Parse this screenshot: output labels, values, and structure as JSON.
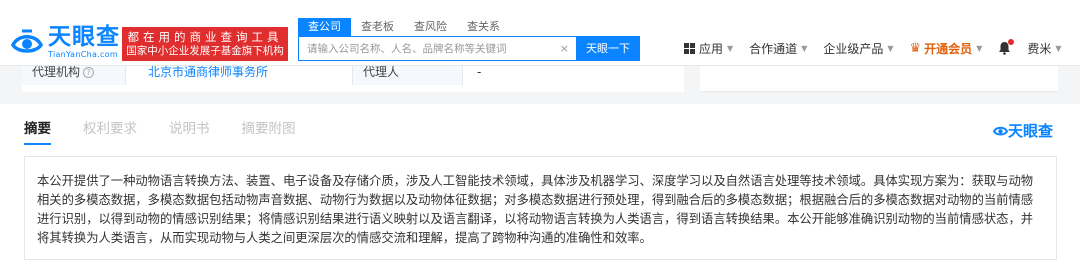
{
  "header": {
    "logo": {
      "name": "天眼查",
      "url": "TianYanCha.com"
    },
    "slogan": {
      "line1": "都在用的商业查询工具",
      "line2": "国家中小企业发展子基金旗下机构"
    },
    "search_tabs": [
      "查公司",
      "查老板",
      "查风险",
      "查关系"
    ],
    "search": {
      "placeholder": "请输入公司名称、人名、品牌名称等关键词",
      "clear": "×",
      "button": "天眼一下"
    },
    "nav": {
      "app": "应用",
      "channel": "合作通道",
      "enterprise": "企业级产品",
      "vip": "开通会员",
      "user": "费米"
    }
  },
  "info": {
    "agency_label": "代理机构",
    "agency_value": "北京市通商律师事务所",
    "agent_label": "代理人",
    "agent_value": "-",
    "help": "?"
  },
  "tabs": [
    "摘要",
    "权利要求",
    "说明书",
    "摘要附图"
  ],
  "watermark": "天眼查",
  "abstract_text": "本公开提供了一种动物语言转换方法、装置、电子设备及存储介质，涉及人工智能技术领域，具体涉及机器学习、深度学习以及自然语言处理等技术领域。具体实现方案为：获取与动物相关的多模态数据，多模态数据包括动物声音数据、动物行为数据以及动物体征数据；对多模态数据进行预处理，得到融合后的多模态数据；根据融合后的多模态数据对动物的当前情感进行识别，以得到动物的情感识别结果；将情感识别结果进行语义映射以及语言翻译，以将动物语言转换为人类语言，得到语言转换结果。本公开能够准确识别动物的当前情感状态，并将其转换为人类语言，从而实现动物与人类之间更深层次的情感交流和理解，提高了跨物种沟通的准确性和效率。",
  "colors": {
    "brand": "#0a84ff",
    "slogan_bg": "#e02d2d",
    "vip": "#e0620d"
  }
}
